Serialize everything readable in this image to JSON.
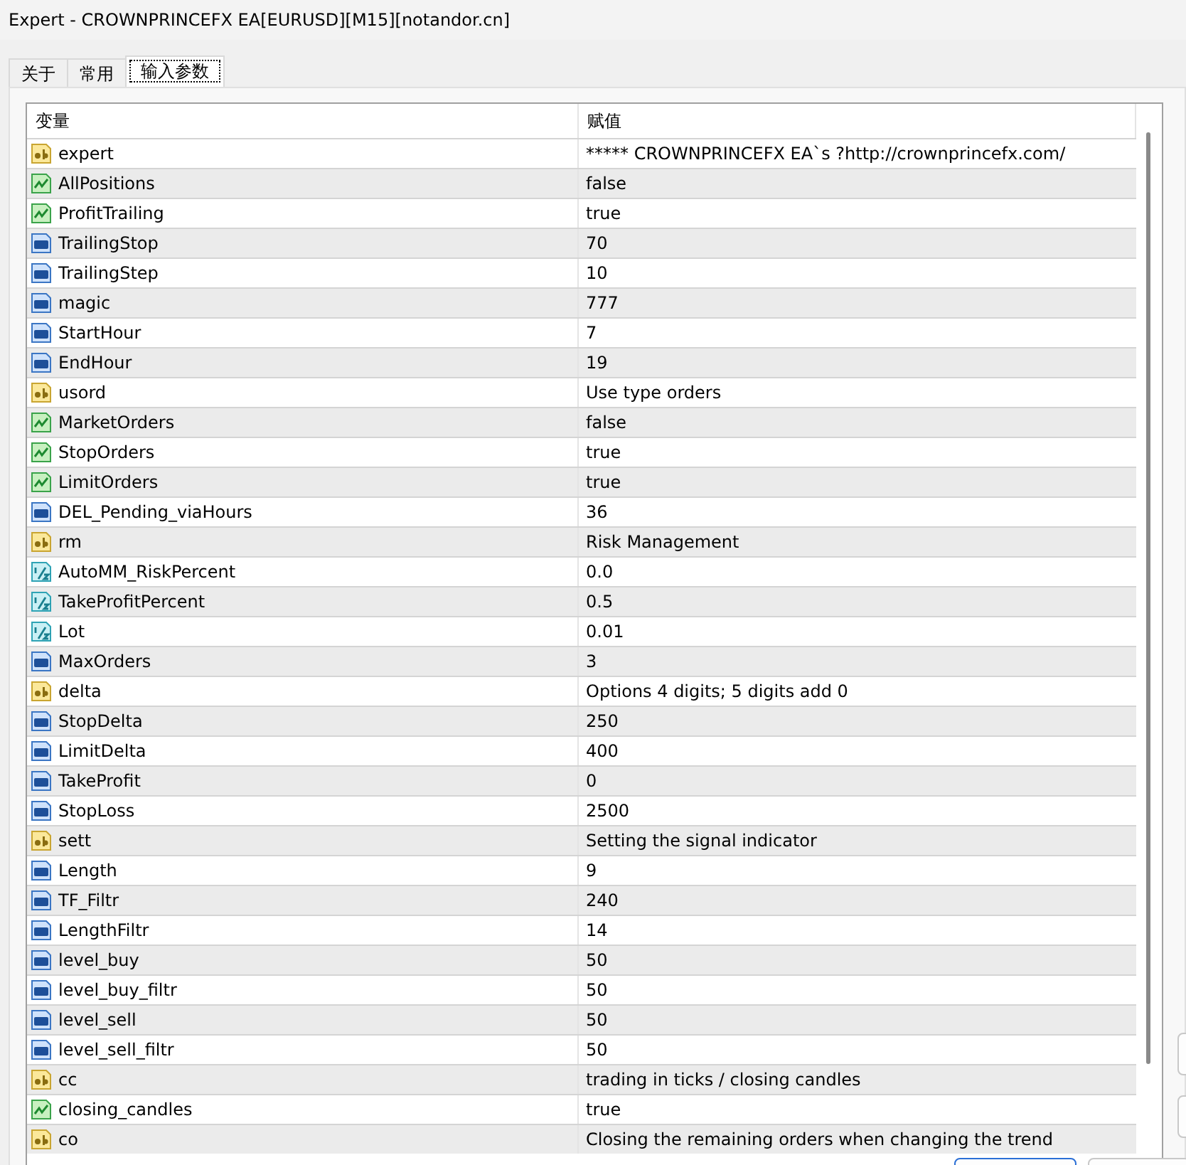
{
  "window": {
    "title": "Expert - CROWNPRINCEFX EA[EURUSD][M15][notandor.cn]"
  },
  "tabs": [
    {
      "label": "关于",
      "selected": false
    },
    {
      "label": "常用",
      "selected": false
    },
    {
      "label": "输入参数",
      "selected": true
    }
  ],
  "table": {
    "columns": [
      "变量",
      "赋值"
    ],
    "rows": [
      {
        "kind": "string",
        "name": "expert",
        "value": "***** CROWNPRINCEFX EA`s ?http://crownprincefx.com/"
      },
      {
        "kind": "bool",
        "name": "AllPositions",
        "value": "false"
      },
      {
        "kind": "bool",
        "name": "ProfitTrailing",
        "value": "true"
      },
      {
        "kind": "int",
        "name": "TrailingStop",
        "value": "70"
      },
      {
        "kind": "int",
        "name": "TrailingStep",
        "value": "10"
      },
      {
        "kind": "int",
        "name": "magic",
        "value": "777"
      },
      {
        "kind": "int",
        "name": "StartHour",
        "value": "7"
      },
      {
        "kind": "int",
        "name": "EndHour",
        "value": "19"
      },
      {
        "kind": "string",
        "name": "usord",
        "value": "Use type orders"
      },
      {
        "kind": "bool",
        "name": "MarketOrders",
        "value": "false"
      },
      {
        "kind": "bool",
        "name": "StopOrders",
        "value": "true"
      },
      {
        "kind": "bool",
        "name": "LimitOrders",
        "value": "true"
      },
      {
        "kind": "int",
        "name": "DEL_Pending_viaHours",
        "value": "36"
      },
      {
        "kind": "string",
        "name": "rm",
        "value": "Risk Management"
      },
      {
        "kind": "double",
        "name": "AutoMM_RiskPercent",
        "value": "0.0"
      },
      {
        "kind": "double",
        "name": "TakeProfitPercent",
        "value": "0.5"
      },
      {
        "kind": "double",
        "name": "Lot",
        "value": "0.01"
      },
      {
        "kind": "int",
        "name": "MaxOrders",
        "value": "3"
      },
      {
        "kind": "string",
        "name": "delta",
        "value": "Options 4 digits; 5 digits add 0"
      },
      {
        "kind": "int",
        "name": "StopDelta",
        "value": "250"
      },
      {
        "kind": "int",
        "name": "LimitDelta",
        "value": "400"
      },
      {
        "kind": "int",
        "name": "TakeProfit",
        "value": "0"
      },
      {
        "kind": "int",
        "name": "StopLoss",
        "value": "2500"
      },
      {
        "kind": "string",
        "name": "sett",
        "value": "Setting the signal indicator"
      },
      {
        "kind": "int",
        "name": "Length",
        "value": "9"
      },
      {
        "kind": "int",
        "name": "TF_Filtr",
        "value": "240"
      },
      {
        "kind": "int",
        "name": "LengthFiltr",
        "value": "14"
      },
      {
        "kind": "int",
        "name": "level_buy",
        "value": "50"
      },
      {
        "kind": "int",
        "name": "level_buy_filtr",
        "value": "50"
      },
      {
        "kind": "int",
        "name": "level_sell",
        "value": "50"
      },
      {
        "kind": "int",
        "name": "level_sell_filtr",
        "value": "50"
      },
      {
        "kind": "string",
        "name": "cc",
        "value": "trading in ticks / closing candles"
      },
      {
        "kind": "bool",
        "name": "closing_candles",
        "value": "true"
      },
      {
        "kind": "string",
        "name": "co",
        "value": "Closing the remaining orders when changing the trend"
      }
    ]
  }
}
